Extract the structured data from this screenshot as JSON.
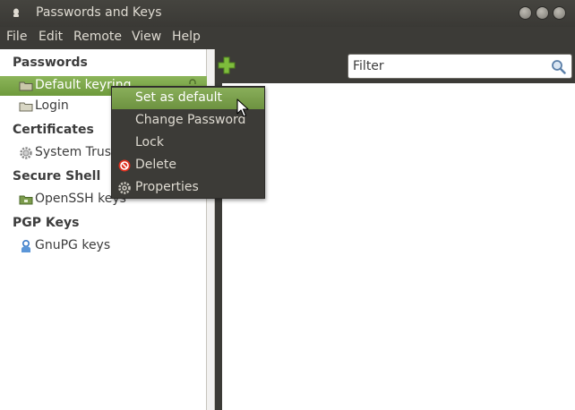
{
  "window": {
    "title": "Passwords and Keys"
  },
  "menubar": {
    "file": "File",
    "edit": "Edit",
    "remote": "Remote",
    "view": "View",
    "help": "Help"
  },
  "sidebar": {
    "passwords_header": "Passwords",
    "passwords_items": [
      "Default keyring",
      "Login"
    ],
    "certificates_header": "Certificates",
    "certificates_items": [
      "System Trust"
    ],
    "ssh_header": "Secure Shell",
    "ssh_items": [
      "OpenSSH keys"
    ],
    "pgp_header": "PGP Keys",
    "pgp_items": [
      "GnuPG keys"
    ]
  },
  "toolbar": {
    "filter_placeholder": "Filter"
  },
  "context_menu": {
    "items": [
      "Set as default",
      "Change Password",
      "Lock",
      "Delete",
      "Properties"
    ]
  },
  "colors": {
    "accent": "#7aa546",
    "chrome": "#3c3b37",
    "menu_text": "#dfdbd2"
  }
}
